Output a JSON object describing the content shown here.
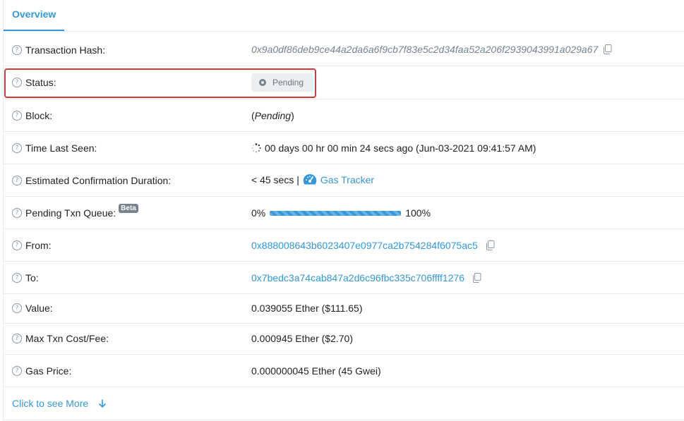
{
  "tabs": [
    {
      "label": "Overview",
      "active": true
    }
  ],
  "rows": {
    "tx_hash": {
      "label": "Transaction Hash:",
      "value": "0x9a0df86deb9ce44a2da6a6f9cb7f83e5c2d34faa52a206f2939043991a029a67"
    },
    "status": {
      "label": "Status:",
      "value": "Pending"
    },
    "block": {
      "label": "Block:",
      "open": "(",
      "value": "Pending",
      "close": ")"
    },
    "time_last_seen": {
      "label": "Time Last Seen:",
      "value": "00 days 00 hr 00 min 24 secs ago (Jun-03-2021 09:41:57 AM)"
    },
    "confirmation": {
      "label": "Estimated Confirmation Duration:",
      "value": "< 45 secs |",
      "link": "Gas Tracker"
    },
    "queue": {
      "label": "Pending Txn Queue:",
      "badge": "Beta",
      "start": "0%",
      "end": "100%",
      "progress": 1.0
    },
    "from": {
      "label": "From:",
      "value": "0x888008643b6023407e0977ca2b754284f6075ac5"
    },
    "to": {
      "label": "To:",
      "value": "0x7bedc3a74cab847a2d6c96fbc335c706ffff1276"
    },
    "value": {
      "label": "Value:",
      "value": "0.039055 Ether ($111.65)"
    },
    "max_fee": {
      "label": "Max Txn Cost/Fee:",
      "value": "0.000945 Ether ($2.70)"
    },
    "gas_price": {
      "label": "Gas Price:",
      "value": "0.000000045 Ether (45 Gwei)"
    }
  },
  "more_link": "Click to see More",
  "colors": {
    "accent": "#3498db",
    "highlight": "#d33b3b",
    "muted": "#77838f"
  },
  "icons": {
    "help": "question-circle-icon",
    "copy": "copy-icon",
    "status": "pending-dot-icon",
    "time": "spinner-icon",
    "gas": "gauge-icon",
    "more": "arrow-down-icon"
  }
}
